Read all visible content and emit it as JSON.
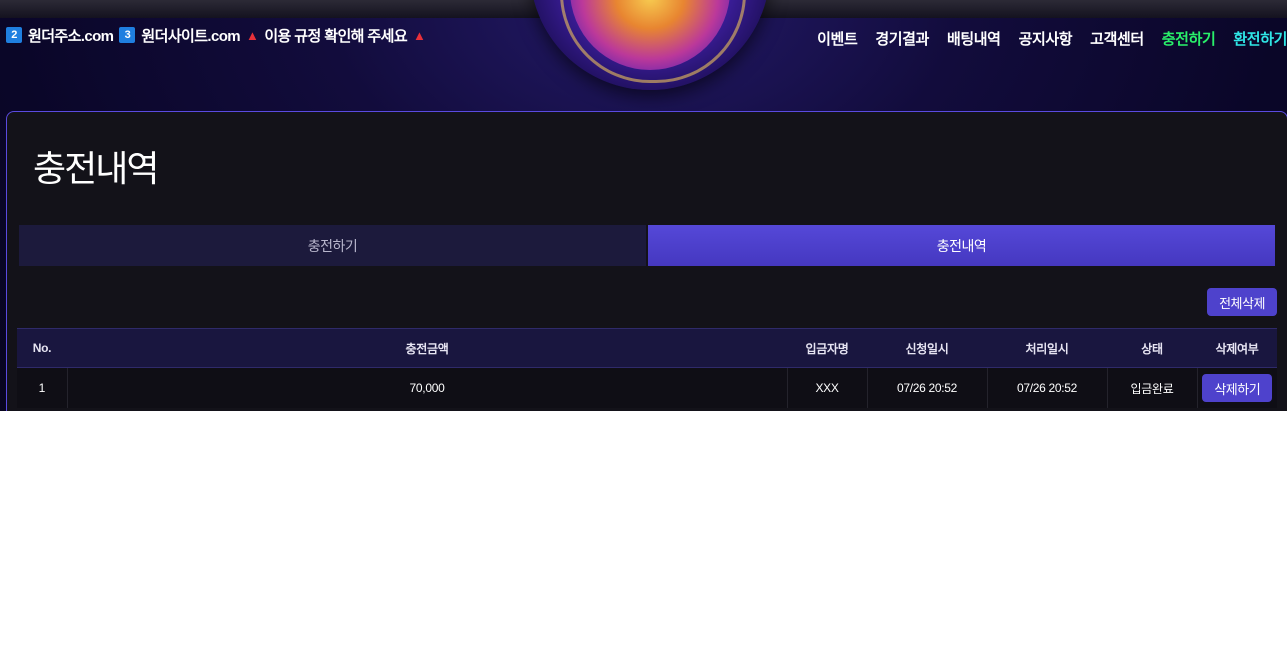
{
  "header": {
    "marquee": {
      "badge1": "2",
      "text1": "원더주소.com",
      "badge2": "3",
      "text2": "원더사이트.com",
      "notice": "이용 규정 확인해 주세요"
    },
    "nav": [
      {
        "label": "이벤트"
      },
      {
        "label": "경기결과"
      },
      {
        "label": "배팅내역"
      },
      {
        "label": "공지사항"
      },
      {
        "label": "고객센터"
      },
      {
        "label": "충전하기",
        "color": "#29f06a"
      },
      {
        "label": "환전하기",
        "color": "#2fe6e6"
      }
    ]
  },
  "main": {
    "title": "충전내역",
    "tabs": [
      {
        "label": "충전하기",
        "active": false
      },
      {
        "label": "충전내역",
        "active": true
      }
    ],
    "delete_all_label": "전체삭제",
    "table": {
      "columns": [
        "No.",
        "충전금액",
        "입금자명",
        "신청일시",
        "처리일시",
        "상태",
        "삭제여부"
      ],
      "rows": [
        {
          "no": "1",
          "amount": "70,000",
          "depositor": "XXX",
          "requested": "07/26 20:52",
          "processed": "07/26 20:52",
          "status": "입금완료",
          "delete_label": "삭제하기"
        }
      ]
    }
  },
  "colors": {
    "accent": "#4e42cc",
    "panel_border": "#5a4ae0",
    "nav_charge": "#29f06a",
    "nav_withdraw": "#2fe6e6"
  }
}
